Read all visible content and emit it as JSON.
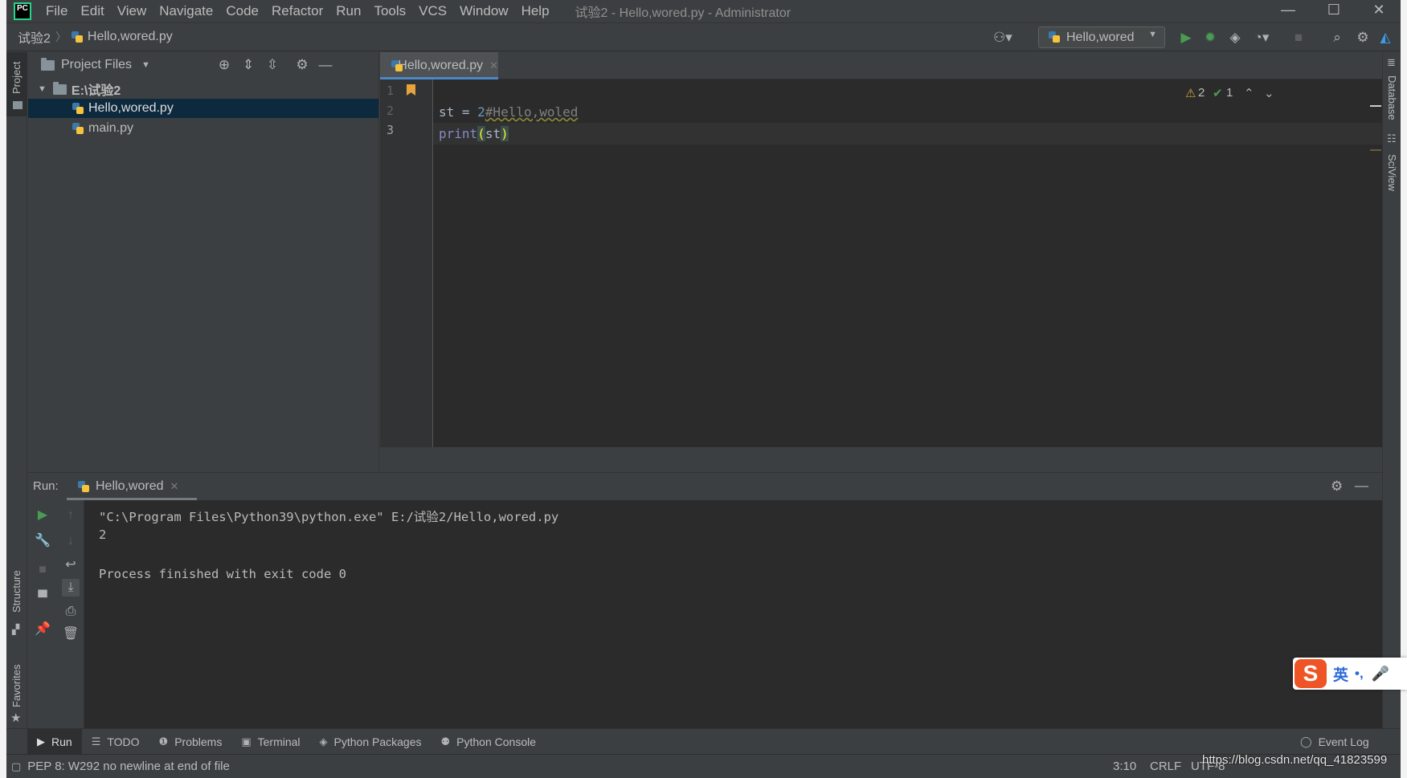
{
  "app": {
    "logo_text": "PC",
    "window_title": "试验2 - Hello,wored.py - Administrator"
  },
  "menu": [
    {
      "label": "File"
    },
    {
      "label": "Edit"
    },
    {
      "label": "View"
    },
    {
      "label": "Navigate"
    },
    {
      "label": "Code"
    },
    {
      "label": "Refactor"
    },
    {
      "label": "Run"
    },
    {
      "label": "Tools"
    },
    {
      "label": "VCS"
    },
    {
      "label": "Window"
    },
    {
      "label": "Help"
    }
  ],
  "window_controls": {
    "minimize": "—",
    "maximize": "☐",
    "close": "✕"
  },
  "breadcrumb": {
    "project": "试验2",
    "file": "Hello,wored.py"
  },
  "toolbar": {
    "run_config": "Hello,wored"
  },
  "project_panel": {
    "title": "Project Files",
    "tree": [
      {
        "label": "E:\\试验2",
        "type": "folder",
        "expanded": true
      },
      {
        "label": "Hello,wored.py",
        "type": "python-file",
        "selected": true
      },
      {
        "label": "main.py",
        "type": "python-file",
        "selected": false
      }
    ]
  },
  "left_stripe": {
    "project": "Project",
    "structure": "Structure",
    "favorites": "Favorites"
  },
  "right_stripe": {
    "database": "Database",
    "sciview": "SciView"
  },
  "editor": {
    "tab": "Hello,wored.py",
    "line_numbers": [
      "1",
      "2",
      "3"
    ],
    "lines": [
      {
        "comment": "#Hello,woled"
      },
      {
        "ident": "st",
        "op": " = ",
        "number": "2"
      },
      {
        "builtin": "print",
        "open": "(",
        "arg": "st",
        "close": ")"
      }
    ],
    "warnings": "2",
    "weak_warnings": "1"
  },
  "run_panel": {
    "label": "Run:",
    "tab": "Hello,wored",
    "output": [
      "\"C:\\Program Files\\Python39\\python.exe\" E:/试验2/Hello,wored.py",
      "2",
      "",
      "Process finished with exit code 0"
    ]
  },
  "tool_windows": [
    {
      "label": "Run",
      "icon": "run-icon",
      "active": true
    },
    {
      "label": "TODO",
      "icon": "todo-icon",
      "active": false
    },
    {
      "label": "Problems",
      "icon": "problems-icon",
      "active": false
    },
    {
      "label": "Terminal",
      "icon": "terminal-icon",
      "active": false
    },
    {
      "label": "Python Packages",
      "icon": "packages-icon",
      "active": false
    },
    {
      "label": "Python Console",
      "icon": "python-console-icon",
      "active": false
    }
  ],
  "event_log": "Event Log",
  "status": {
    "message": "PEP 8: W292 no newline at end of file",
    "position": "3:10",
    "line_separator": "CRLF",
    "encoding": "UTF-8"
  },
  "ime": {
    "logo": "S",
    "mode": "英",
    "punct": "•,"
  },
  "watermark": "https://blog.csdn.net/qq_41823599"
}
